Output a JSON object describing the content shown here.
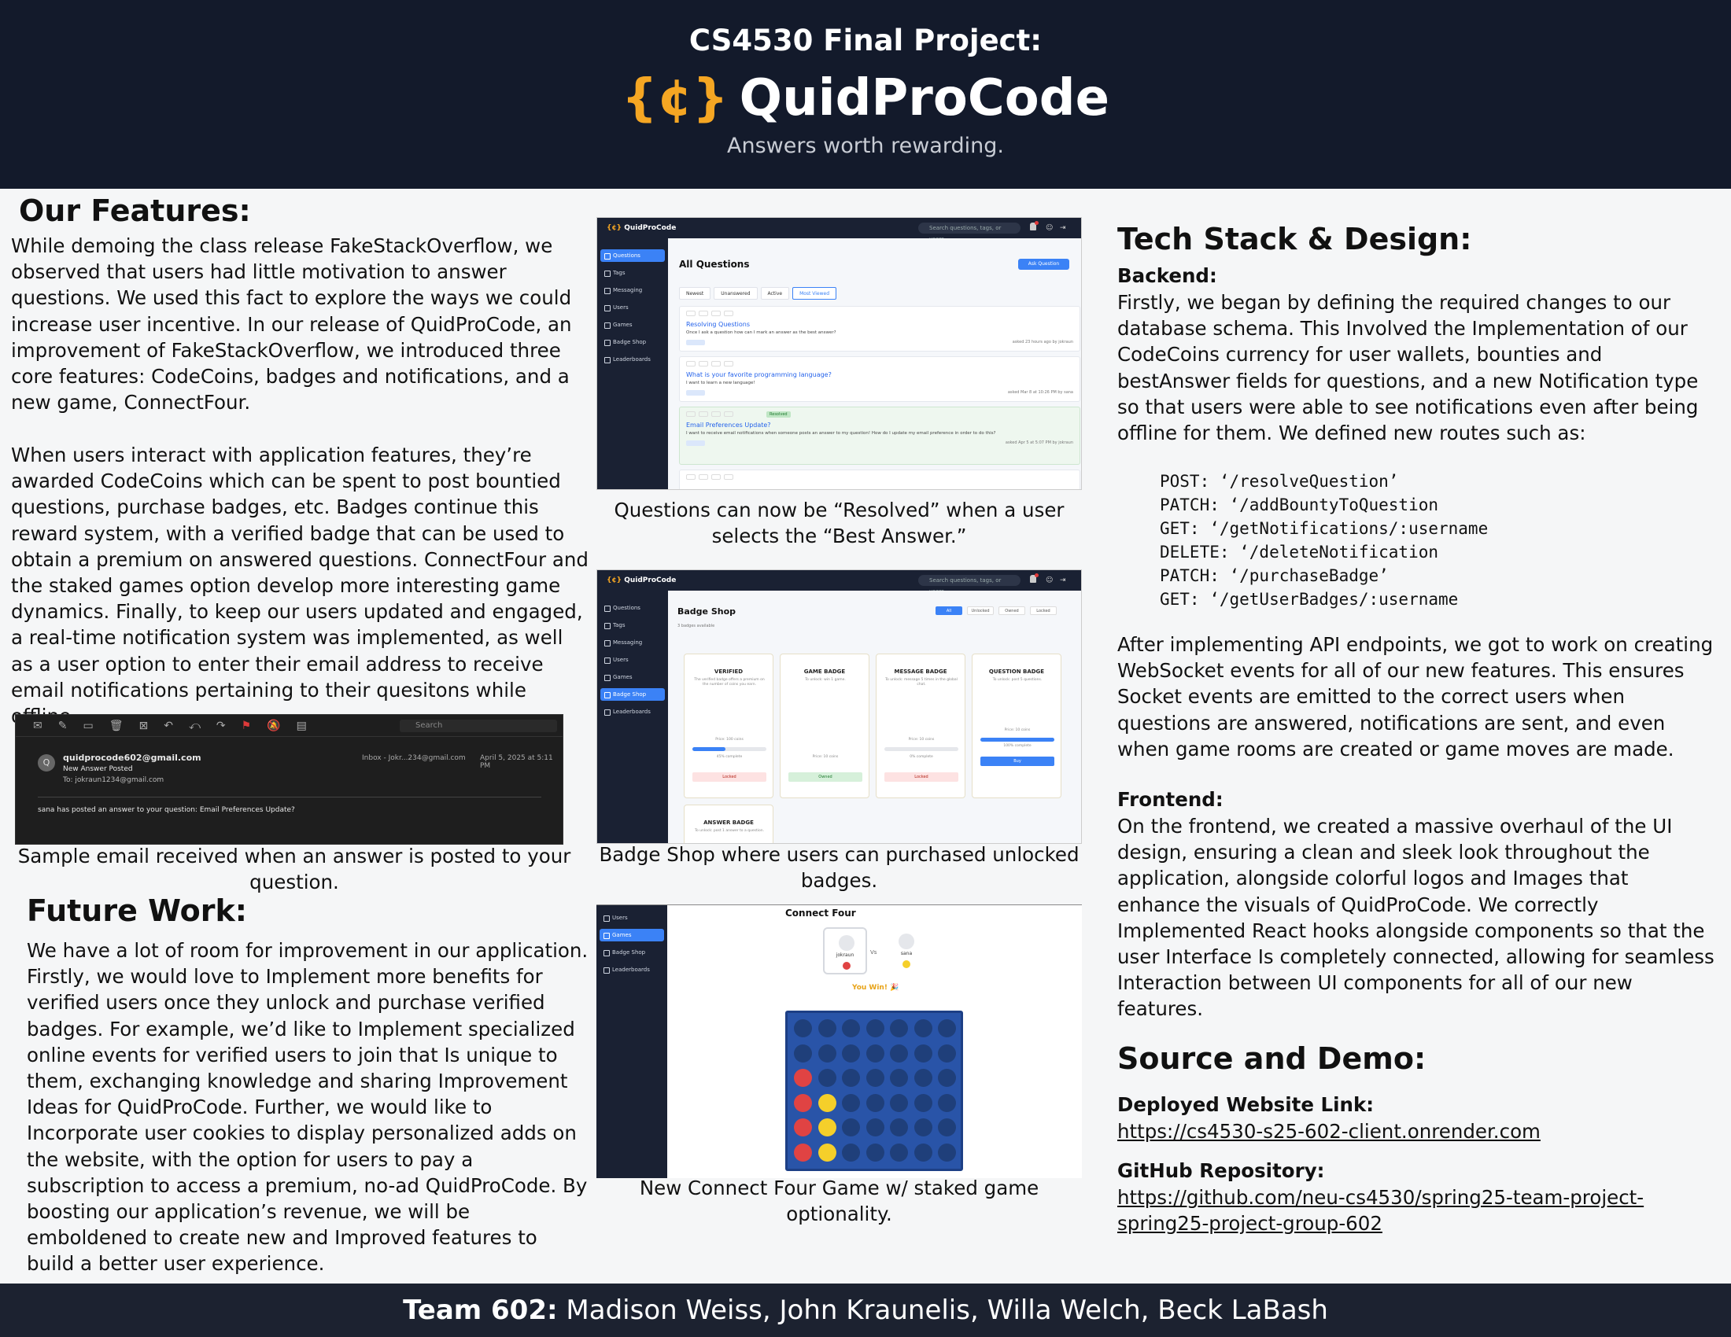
{
  "header": {
    "top_line": "CS4530 Final Project:",
    "logo": "{¢}",
    "brand": "QuidProCode",
    "tagline": "Answers worth rewarding.",
    "logo_color": "#f5a623",
    "bg_color": "#131a2b"
  },
  "features": {
    "title": "Our Features:",
    "p1": "While demoing the class release FakeStackOverflow, we observed that users had little motivation to answer questions. We used this fact to explore the ways we could increase user incentive. In our release of QuidProCode, an improvement of FakeStackOverflow, we introduced three core features: CodeCoins, badges and notifications, and a new game, ConnectFour.",
    "p2": "When users interact with application features, they’re awarded CodeCoins which can be spent to post bountied questions, purchase badges, etc. Badges continue this reward system, with a verified badge that can be used to obtain a premium on answered questions. ConnectFour and the staked games option develop more interesting game dynamics. Finally, to keep our users updated and engaged, a real-time notification system was implemented, as well as a user option to enter their email address to receive email notifications pertaining to their quesitons while offline.",
    "email_caption": "Sample email received when an answer is posted to your question."
  },
  "email": {
    "search": "Search",
    "avatar": "Q",
    "from": "quidprocode602@gmail.com",
    "subject": "New Answer Posted",
    "to": "To:  jokraun1234@gmail.com",
    "inbox": "Inbox - Jokr...234@gmail.com",
    "date": "April 5, 2025 at 5:11 PM",
    "body": "sana has posted an answer to your question: Email Preferences Update?"
  },
  "future": {
    "title": "Future Work:",
    "p": "We have a lot of room for improvement in our application.  Firstly, we would love to Implement more benefits for verified users once they unlock and purchase verified badges.  For example, we’d like to Implement specialized online events for verified users to join that Is unique to them, exchanging knowledge and sharing Improvement Ideas for QuidProCode.  Further, we would like to Incorporate user cookies to display personalized adds on the website, with the option for users to pay a subscription to access a premium, no-ad QuidProCode.  By boosting our application’s revenue, we will be emboldened to create new and Improved features to build a better user experience."
  },
  "shots": {
    "app_logo": "{¢}",
    "app_name": "QuidProCode",
    "search_placeholder": "Search questions, tags, or users...",
    "sidebar": [
      "Questions",
      "Tags",
      "Messaging",
      "Users",
      "Games",
      "Badge Shop",
      "Leaderboards"
    ],
    "questions": {
      "title": "All Questions",
      "ask_button": "Ask Question",
      "tabs": [
        "Newest",
        "Unanswered",
        "Active",
        "Most Viewed"
      ],
      "cards": [
        {
          "title": "Resolving Questions",
          "text": "Once I ask a question how can I mark an answer as the best answer?",
          "meta": "asked 23 hours ago by jokraun"
        },
        {
          "title": "What is your favorite programming language?",
          "text": "I want to learn a new language!",
          "meta": "asked Mar 8 at 10:26 PM by sana"
        },
        {
          "title": "Email Preferences Update?",
          "text": "I want to receive email notifications when someone posts an answer to my question! How do I update my email preference in order to do this?",
          "meta": "asked Apr 5 at 5:07 PM by jokraun",
          "badge": "Resolved"
        }
      ],
      "caption": "Questions can now be “Resolved” when a user selects the “Best Answer.”"
    },
    "shop": {
      "title": "Badge Shop",
      "subtitle": "3 badges available",
      "tabs": [
        "All",
        "Unlocked",
        "Owned",
        "Locked"
      ],
      "badges": [
        {
          "name": "VERIFIED",
          "desc": "The verified badge offers a premium on the number of coins you earn.",
          "price": "Price: 100 coins",
          "progress": 0.45,
          "progress_label": "45% complete",
          "action": "Locked",
          "state": "locked"
        },
        {
          "name": "GAME BADGE",
          "desc": "To unlock: win 1 game.",
          "price": "Price: 10 coins",
          "progress": 0,
          "progress_label": "",
          "action": "Owned",
          "state": "owned"
        },
        {
          "name": "MESSAGE BADGE",
          "desc": "To unlock: message 5 times in the global chat.",
          "price": "Price: 10 coins",
          "progress": 0,
          "progress_label": "0% complete",
          "action": "Locked",
          "state": "locked"
        },
        {
          "name": "QUESTION BADGE",
          "desc": "To unlock: post 5 questions.",
          "price": "Price: 10 coins",
          "progress": 1.0,
          "progress_label": "100% complete",
          "action": "Buy",
          "state": "buy"
        },
        {
          "name": "ANSWER BADGE",
          "desc": "To unlock: post 1 answer to a question.",
          "price": "",
          "progress": 0,
          "progress_label": "",
          "action": "",
          "state": "locked"
        }
      ],
      "caption": "Badge Shop where users can purchased unlocked badges."
    },
    "connect_four": {
      "title": "Connect Four",
      "player1": "jokraun",
      "player2": "sana",
      "vs": "Vs",
      "result": "You Win! 🎉",
      "caption": "New Connect Four Game w/ staked game optionality.",
      "board_color": "#2954a8",
      "red_color": "#e04343",
      "yellow_color": "#f5cf2a",
      "empty_color": "#1f3f7a"
    }
  },
  "tech": {
    "title": "Tech Stack & Design:",
    "backend_heading": "Backend:",
    "backend_p": "Firstly, we began by defining the required changes to our database schema.  This Involved the Implementation of our CodeCoins currency for user wallets, bounties and bestAnswer fields for questions, and a new Notification type so that users were able to see notifications even after being offline for them.  We defined new routes such as:",
    "routes": [
      "POST: ‘/resolveQuestion’",
      "PATCH: ‘/addBountyToQuestion",
      "GET: ‘/getNotifications/:username",
      "DELETE: ‘/deleteNotification",
      "PATCH: ‘/purchaseBadge’",
      "GET: ‘/getUserBadges/:username"
    ],
    "api_p": "After implementing API endpoints, we got to work on creating WebSocket events for all of our new features.  This ensures Socket events are emitted to the correct users when questions are answered, notifications are sent, and even when game rooms are created or game moves are made.",
    "frontend_heading": "Frontend:",
    "frontend_p": "On the frontend, we created a massive overhaul of the UI design, ensuring a clean and sleek look throughout the application, alongside colorful logos and Images that enhance the visuals of QuidProCode.  We correctly Implemented React hooks alongside components so that the user Interface Is completely connected, allowing for seamless Interaction between UI components for all of our new features."
  },
  "source": {
    "title": "Source and Demo:",
    "deploy_heading": "Deployed Website Link:",
    "deploy_link": "https://cs4530-s25-602-client.onrender.com",
    "github_heading": "GitHub Repository:",
    "github_link": "https://github.com/neu-cs4530/spring25-team-project-spring25-project-group-602"
  },
  "footer": {
    "team_label": "Team 602:",
    "members": " Madison Weiss, John Kraunelis, Willa Welch, Beck LaBash"
  }
}
